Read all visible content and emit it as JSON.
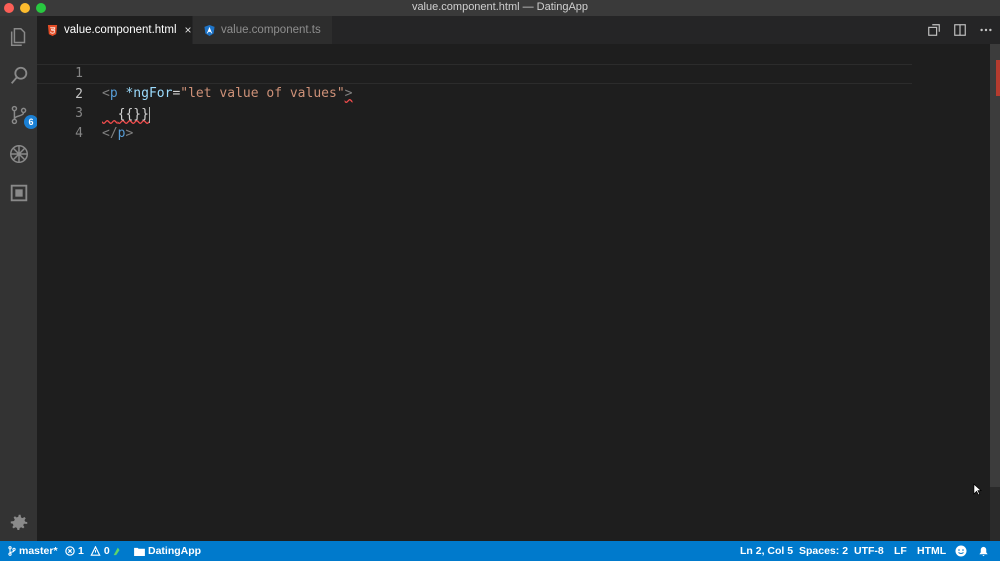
{
  "window": {
    "title": "value.component.html — DatingApp"
  },
  "activity_bar": {
    "items": [
      "explorer-icon",
      "search-icon",
      "source-control-icon",
      "debug-icon",
      "extensions-icon"
    ],
    "source_control_badge": "6",
    "bottom": "gear-icon"
  },
  "tabs": [
    {
      "label": "value.component.html",
      "icon": "html5-icon",
      "active": true,
      "close": "×"
    },
    {
      "label": "value.component.ts",
      "icon": "angular-icon",
      "active": false
    }
  ],
  "editor": {
    "lines": [
      {
        "number": "1",
        "open": "<",
        "tag": "p",
        "attr": "*ngFor",
        "eq": "=",
        "value": "\"let value of values\"",
        "close": ">"
      },
      {
        "number": "2",
        "text": "{{}}"
      },
      {
        "number": "3",
        "open": "</",
        "tag": "p",
        "close": ">"
      },
      {
        "number": "4"
      }
    ]
  },
  "status_bar": {
    "branch": "master*",
    "errors": "1",
    "warnings": "0",
    "folder": "DatingApp",
    "position": "Ln 2, Col 5",
    "spaces": "Spaces: 2",
    "encoding": "UTF-8",
    "eol": "LF",
    "language": "HTML"
  },
  "colors": {
    "status_bar": "#007acc",
    "activity_bar": "#333333",
    "editor_bg": "#1e1e1e"
  }
}
